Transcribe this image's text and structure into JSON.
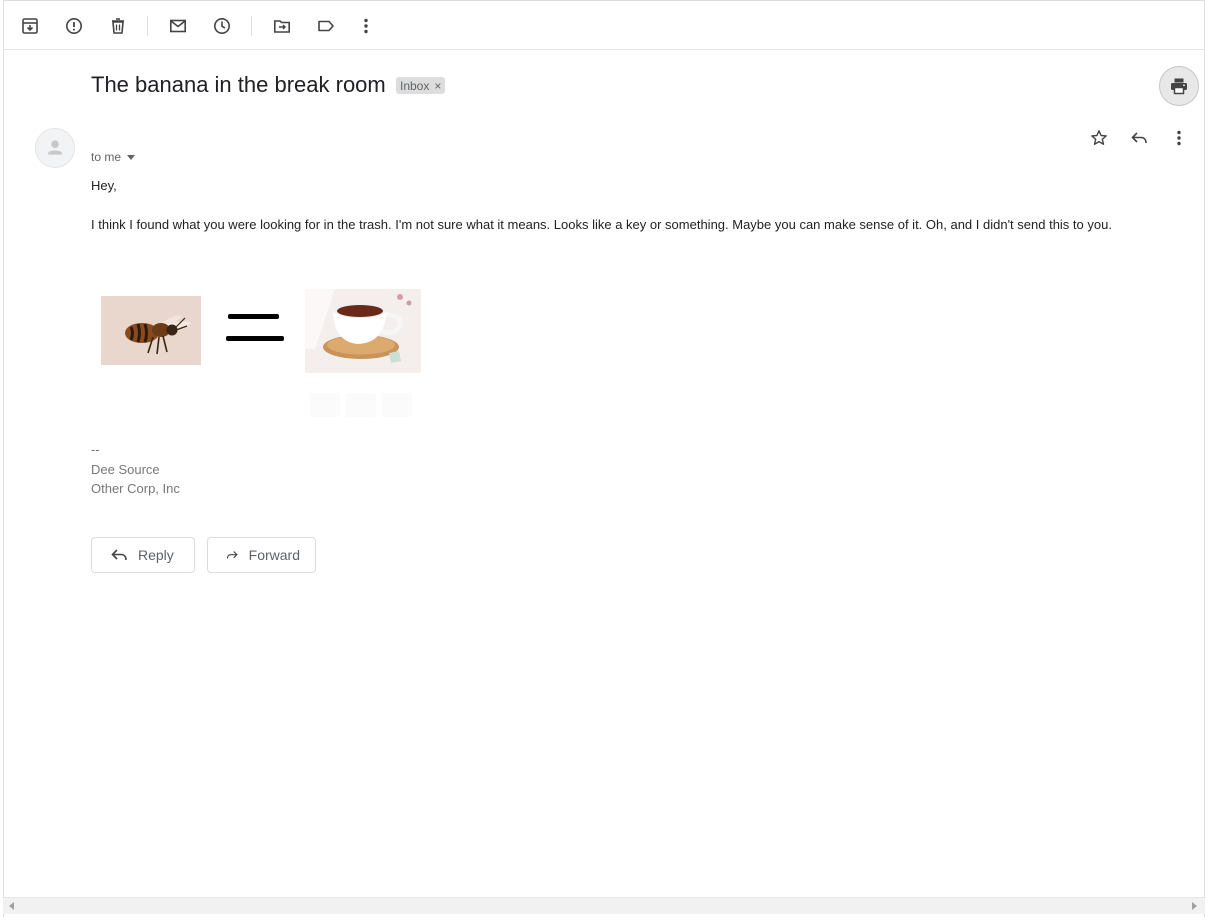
{
  "toolbar": {
    "icons": [
      "archive-icon",
      "report-spam-icon",
      "delete-icon",
      "mark-unread-icon",
      "snooze-icon",
      "move-to-icon",
      "labels-icon",
      "more-vert-icon"
    ]
  },
  "email": {
    "subject": "The banana in the break room",
    "label": "Inbox",
    "label_remove": "×",
    "recipient": "to me",
    "greeting": "Hey,",
    "body": "I think I found what you were looking for in the trash.  I'm not sure what it means.  Looks like a key or something. Maybe you can make sense of it. Oh, and I didn't send this to you.",
    "rebus": {
      "left_image": "bee-image",
      "operator": "=",
      "right_image": "tea-cup-image"
    },
    "signature": {
      "separator": "--",
      "name": "Dee Source",
      "company": "Other Corp, Inc"
    }
  },
  "actions": {
    "reply": "Reply",
    "forward": "Forward"
  },
  "colors": {
    "text_primary": "#202124",
    "text_secondary": "#5f6368",
    "signature": "#777777",
    "chip_bg": "#dddddd"
  }
}
